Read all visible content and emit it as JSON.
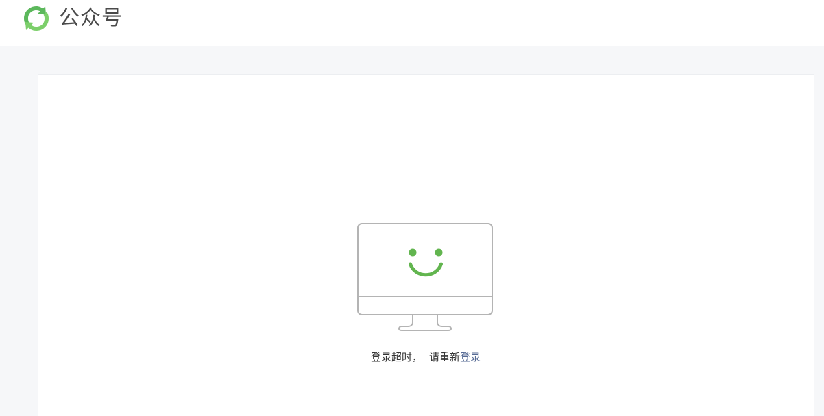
{
  "header": {
    "brand_name": "公众号",
    "logo_icon": "wechat-official-account-logo-icon",
    "brand_color": "#5cb85c"
  },
  "main": {
    "illustration_icon": "smiling-monitor-icon",
    "message": {
      "prefix": "登录超时，",
      "middle": "请重新",
      "link_label": "登录"
    },
    "link_color": "#576b95",
    "accent_color": "#62b54f"
  }
}
